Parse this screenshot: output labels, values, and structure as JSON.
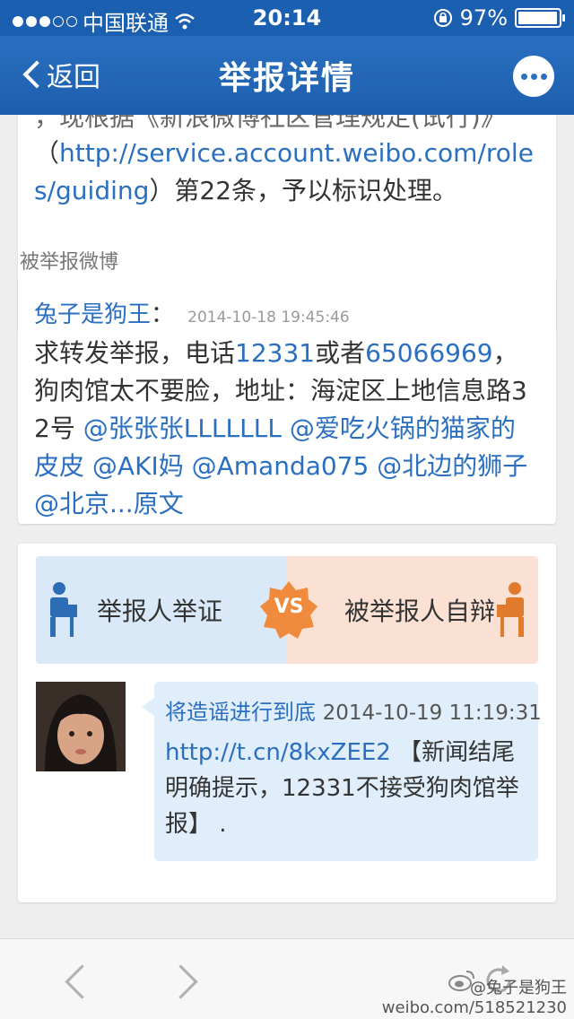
{
  "status_bar": {
    "carrier": "中国联通",
    "time": "20:14",
    "battery": "97%",
    "battery_level": 0.97
  },
  "nav": {
    "back_label": "返回",
    "title": "举报详情"
  },
  "report_notice": {
    "line1": "，现根据《新浪微博社区管理规定(试行)》",
    "before_link": "（",
    "link": "http://service.account.weibo.com/roles/guiding",
    "after_link": "）第22条，予以标识处理。"
  },
  "section_label": "被举报微博",
  "reported_weibo": {
    "author": "兔子是狗王",
    "colon": "：",
    "time": "2014-10-18 19:45:46",
    "text_parts": [
      {
        "text": "求转发举报，电话",
        "link": false
      },
      {
        "text": "12331",
        "link": true
      },
      {
        "text": "或者",
        "link": false
      },
      {
        "text": "65066969",
        "link": true
      },
      {
        "text": "，狗肉馆太不要脸，地址：海淀区上地信息路32号 ",
        "link": false
      },
      {
        "text": "@张张张LLLLLLL",
        "link": true
      },
      {
        "text": " ",
        "link": false
      },
      {
        "text": "@爱吃火锅的猫家的皮皮",
        "link": true
      },
      {
        "text": " ",
        "link": false
      },
      {
        "text": "@AKI妈",
        "link": true
      },
      {
        "text": " ",
        "link": false
      },
      {
        "text": "@Amanda075",
        "link": true
      },
      {
        "text": " ",
        "link": false
      },
      {
        "text": "@北边的狮子",
        "link": true
      },
      {
        "text": " ",
        "link": false
      },
      {
        "text": "@北京...原文",
        "link": true
      }
    ]
  },
  "dispute": {
    "reporter_label": "举报人举证",
    "vs_label": "VS",
    "reported_label": "被举报人自辩",
    "colors": {
      "reporter_bg": "#d9e9f8",
      "reported_bg": "#fbe1d3",
      "vs_badge": "#f08a3c"
    }
  },
  "reply": {
    "author": "将造谣进行到底",
    "time": "2014-10-19 11:19:31",
    "link": "http://t.cn/8kxZEE2",
    "text": " 【新闻结尾明确提示，12331不接受狗肉馆举报】 ."
  },
  "watermark": {
    "user": "@兔子是狗王",
    "url": "weibo.com/518521230"
  },
  "icons": [
    "wifi-icon",
    "lock-rotation-icon",
    "battery-icon",
    "back-chevron-icon",
    "more-icon",
    "reporter-person-icon",
    "vs-badge-icon",
    "reported-person-icon",
    "toolbar-back-icon",
    "toolbar-forward-icon",
    "refresh-icon",
    "weibo-logo-icon"
  ]
}
